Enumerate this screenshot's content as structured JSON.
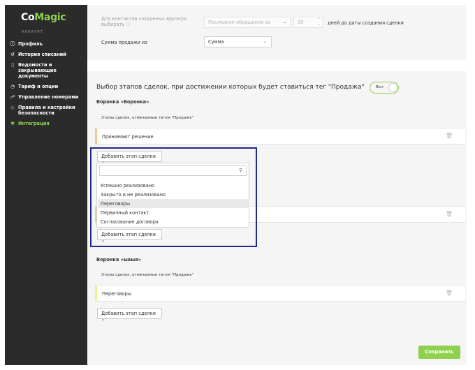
{
  "sidebar": {
    "logo_co": "Co",
    "logo_magic": "Magic",
    "account_label": "АККАУНТ",
    "items": [
      {
        "icon": "ⓘ",
        "label": "Профиль"
      },
      {
        "icon": "↺",
        "label": "История списаний"
      },
      {
        "icon": "▯",
        "label": "Ведомости и закрывающие документы"
      },
      {
        "icon": "◔",
        "label": "Тариф и опции"
      },
      {
        "icon": "☍",
        "label": "Управление номерами"
      },
      {
        "icon": "◇",
        "label": "Правила и настройки безопасности"
      },
      {
        "icon": "✱",
        "label": "Интеграция"
      }
    ]
  },
  "settings": {
    "manual_contacts_label": "Для контактов созданных вручную выбирать ⓘ",
    "last_contact_select": "Последнее обращение за",
    "days_value": "20",
    "days_suffix": "дней до даты создания сделки",
    "sale_sum_label": "Сумма продажи из",
    "sale_sum_select": "Сумма"
  },
  "stages_section": {
    "title": "Выбор этапов сделок, при достижении которых будет ставиться тег \"Продажа\"",
    "toggle_label": "Вкл",
    "stages_caption": "Этапы сделок, отмечаемые тегом \"Продажа\"",
    "add_stage_label": "Добавить этап сделки ⌄",
    "funnels": [
      {
        "title": "Воронка «Воронка»",
        "stages": [
          "Принимают решение"
        ]
      },
      {
        "title": "Воронка «ыаыа»",
        "stages": [
          "Переговоры"
        ]
      }
    ]
  },
  "dropdown": {
    "search_placeholder": "",
    "options": [
      "Успешно реализовано",
      "Закрыто и не реализовано",
      "Переговоры",
      "Первичный контакт",
      "Согласование договора"
    ],
    "highlighted": "Переговоры"
  },
  "footer": {
    "save_label": "Сохранить"
  },
  "colors": {
    "accent": "#8fd14f",
    "sidebar_bg": "#2b2b2b",
    "stage_bar_1": "#f0c98b",
    "stage_bar_2": "#eef18a",
    "focus": "#1e2a8a"
  }
}
